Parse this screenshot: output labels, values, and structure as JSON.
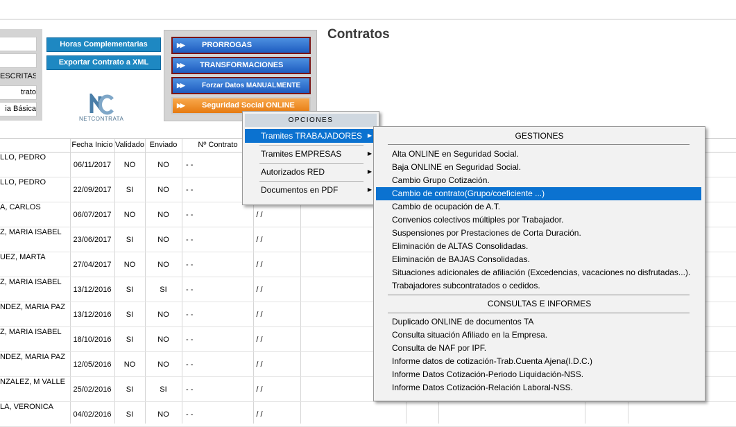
{
  "page_title": "Contratos",
  "left_fields": [
    "",
    "",
    "ESCRITAS",
    "trato",
    "ia Básica"
  ],
  "buttons": {
    "horas": "Horas Complementarias",
    "exportar": "Exportar Contrato a XML"
  },
  "logo": {
    "text": "NETCONTRATA"
  },
  "action_buttons": [
    {
      "label": "PRORROGAS",
      "arrows": "▶▶"
    },
    {
      "label": "TRANSFORMACIONES",
      "arrows": "▶▶"
    },
    {
      "label": "Forzar Datos MANUALMENTE",
      "arrows": "▶▶"
    },
    {
      "label": "Seguridad Social ONLINE",
      "arrows": "▶▶"
    }
  ],
  "table": {
    "headers": [
      "Fecha Inicio",
      "Validado",
      "Enviado",
      "Nº Contrato"
    ],
    "rows": [
      {
        "name": "LLO, PEDRO",
        "fecha": "06/11/2017",
        "validado": "NO",
        "enviado": "NO",
        "contrato": "-  -",
        "extra": ""
      },
      {
        "name": "LLO, PEDRO",
        "fecha": "22/09/2017",
        "validado": "SI",
        "enviado": "NO",
        "contrato": "-  -",
        "extra": ""
      },
      {
        "name": "A, CARLOS",
        "fecha": "06/07/2017",
        "validado": "NO",
        "enviado": "NO",
        "contrato": "-  -",
        "extra": "/ /"
      },
      {
        "name": "Z, MARIA ISABEL",
        "fecha": "23/06/2017",
        "validado": "SI",
        "enviado": "NO",
        "contrato": "-  -",
        "extra": "/ /"
      },
      {
        "name": "UEZ, MARTA",
        "fecha": "27/04/2017",
        "validado": "NO",
        "enviado": "NO",
        "contrato": "-  -",
        "extra": "/ /"
      },
      {
        "name": "Z, MARIA ISABEL",
        "fecha": "13/12/2016",
        "validado": "SI",
        "enviado": "SI",
        "contrato": "-  -",
        "extra": "/ /"
      },
      {
        "name": "NDEZ, MARIA PAZ",
        "fecha": "13/12/2016",
        "validado": "SI",
        "enviado": "NO",
        "contrato": "-  -",
        "extra": "/ /"
      },
      {
        "name": "Z, MARIA ISABEL",
        "fecha": "18/10/2016",
        "validado": "SI",
        "enviado": "NO",
        "contrato": "-  -",
        "extra": "/ /"
      },
      {
        "name": "NDEZ, MARIA PAZ",
        "fecha": "12/05/2016",
        "validado": "NO",
        "enviado": "NO",
        "contrato": "-  -",
        "extra": "/ /"
      },
      {
        "name": "NZALEZ, M VALLE",
        "fecha": "25/02/2016",
        "validado": "SI",
        "enviado": "SI",
        "contrato": "-  -",
        "extra": "/ /"
      },
      {
        "name": "LA, VERONICA",
        "fecha": "04/02/2016",
        "validado": "SI",
        "enviado": "NO",
        "contrato": "-  -",
        "extra": "/ /"
      }
    ]
  },
  "menu1": {
    "header": "OPCIONES",
    "items": [
      {
        "label": "Tramites TRABAJADORES",
        "chevron": "▶"
      },
      {
        "label": "Tramites EMPRESAS",
        "chevron": "▶"
      },
      {
        "label": "Autorizados RED",
        "chevron": "▶"
      },
      {
        "label": "Documentos en PDF",
        "chevron": "▶"
      }
    ]
  },
  "menu2": {
    "gestiones_header": "GESTIONES",
    "gestiones": [
      "Alta ONLINE en Seguridad Social.",
      "Baja ONLINE en Seguridad Social.",
      "Cambio Grupo Cotización.",
      "Cambio de contrato(Grupo/coeficiente ...)",
      "Cambio de ocupación de A.T.",
      "Convenios colectivos múltiples por Trabajador.",
      "Suspensiones por Prestaciones de Corta Duración.",
      "Eliminación de ALTAS Consolidadas.",
      "Eliminación de BAJAS Consolidadas.",
      "Situaciones adicionales de afiliación (Excedencias, vacaciones no disfrutadas...).",
      "Trabajadores subcontratados o cedidos."
    ],
    "consultas_header": "CONSULTAS E INFORMES",
    "consultas": [
      "Duplicado ONLINE de documentos TA",
      "Consulta situación Afiliado en la Empresa.",
      "Consulta de NAF por IPF.",
      "Informe datos de cotización-Trab.Cuenta Ajena(I.D.C.)",
      "Informe Datos Cotización-Periodo Liquidación-NSS.",
      "Informe Datos Cotización-Relación Laboral-NSS."
    ]
  },
  "colors": {
    "accent": "#1e88c2",
    "selection": "#0b72d0",
    "orange": "#f08c20",
    "dark_red": "#7b1515"
  }
}
